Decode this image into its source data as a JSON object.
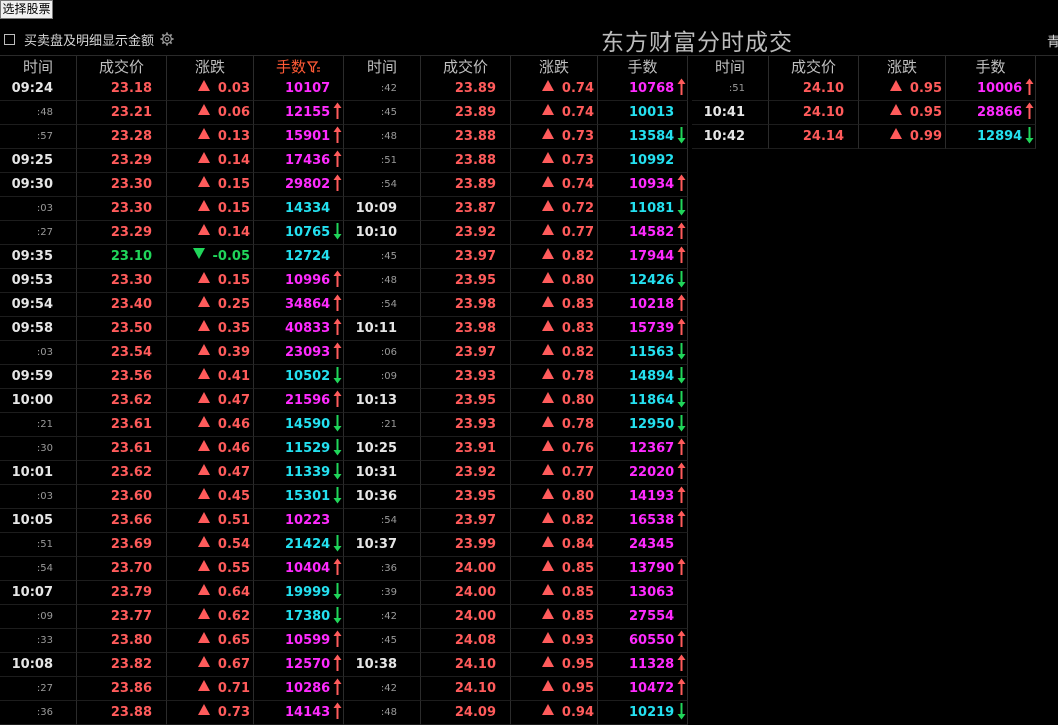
{
  "toolbar": {
    "select_stock_label": "选择股票",
    "show_amount_label": "买卖盘及明细显示金额",
    "show_amount_checked": false
  },
  "title": "东方财富分时成交",
  "corner_text": "青",
  "headers": [
    "时间",
    "成交价",
    "涨跌",
    "手数",
    "时间",
    "成交价",
    "涨跌",
    "手数",
    "时间",
    "成交价",
    "涨跌",
    "手数"
  ],
  "active_header_index": 3,
  "colors": {
    "up": "#ff5b5b",
    "down": "#20d65a",
    "buy_volume": "#ff2bff",
    "sell_volume": "#24e0f0",
    "active_header": "#ff5a36"
  },
  "columns": [
    [
      {
        "time": "09:24",
        "price": "23.18",
        "change": "0.03",
        "dir": "up",
        "vol": "10107",
        "side": "buy",
        "arrow": "none"
      },
      {
        "time": ":48",
        "price": "23.21",
        "change": "0.06",
        "dir": "up",
        "vol": "12155",
        "side": "buy",
        "arrow": "up"
      },
      {
        "time": ":57",
        "price": "23.28",
        "change": "0.13",
        "dir": "up",
        "vol": "15901",
        "side": "buy",
        "arrow": "up"
      },
      {
        "time": "09:25",
        "price": "23.29",
        "change": "0.14",
        "dir": "up",
        "vol": "17436",
        "side": "buy",
        "arrow": "up"
      },
      {
        "time": "09:30",
        "price": "23.30",
        "change": "0.15",
        "dir": "up",
        "vol": "29802",
        "side": "buy",
        "arrow": "up"
      },
      {
        "time": ":03",
        "price": "23.30",
        "change": "0.15",
        "dir": "up",
        "vol": "14334",
        "side": "sell",
        "arrow": "none"
      },
      {
        "time": ":27",
        "price": "23.29",
        "change": "0.14",
        "dir": "up",
        "vol": "10765",
        "side": "sell",
        "arrow": "down"
      },
      {
        "time": "09:35",
        "price": "23.10",
        "change": "-0.05",
        "dir": "down",
        "vol": "12724",
        "side": "sell",
        "arrow": "none"
      },
      {
        "time": "09:53",
        "price": "23.30",
        "change": "0.15",
        "dir": "up",
        "vol": "10996",
        "side": "buy",
        "arrow": "up"
      },
      {
        "time": "09:54",
        "price": "23.40",
        "change": "0.25",
        "dir": "up",
        "vol": "34864",
        "side": "buy",
        "arrow": "up"
      },
      {
        "time": "09:58",
        "price": "23.50",
        "change": "0.35",
        "dir": "up",
        "vol": "40833",
        "side": "buy",
        "arrow": "up"
      },
      {
        "time": ":03",
        "price": "23.54",
        "change": "0.39",
        "dir": "up",
        "vol": "23093",
        "side": "buy",
        "arrow": "up"
      },
      {
        "time": "09:59",
        "price": "23.56",
        "change": "0.41",
        "dir": "up",
        "vol": "10502",
        "side": "sell",
        "arrow": "down"
      },
      {
        "time": "10:00",
        "price": "23.62",
        "change": "0.47",
        "dir": "up",
        "vol": "21596",
        "side": "buy",
        "arrow": "up"
      },
      {
        "time": ":21",
        "price": "23.61",
        "change": "0.46",
        "dir": "up",
        "vol": "14590",
        "side": "sell",
        "arrow": "down"
      },
      {
        "time": ":30",
        "price": "23.61",
        "change": "0.46",
        "dir": "up",
        "vol": "11529",
        "side": "sell",
        "arrow": "down"
      },
      {
        "time": "10:01",
        "price": "23.62",
        "change": "0.47",
        "dir": "up",
        "vol": "11339",
        "side": "sell",
        "arrow": "down"
      },
      {
        "time": ":03",
        "price": "23.60",
        "change": "0.45",
        "dir": "up",
        "vol": "15301",
        "side": "sell",
        "arrow": "down"
      },
      {
        "time": "10:05",
        "price": "23.66",
        "change": "0.51",
        "dir": "up",
        "vol": "10223",
        "side": "buy",
        "arrow": "none"
      },
      {
        "time": ":51",
        "price": "23.69",
        "change": "0.54",
        "dir": "up",
        "vol": "21424",
        "side": "sell",
        "arrow": "down"
      },
      {
        "time": ":54",
        "price": "23.70",
        "change": "0.55",
        "dir": "up",
        "vol": "10404",
        "side": "buy",
        "arrow": "up"
      },
      {
        "time": "10:07",
        "price": "23.79",
        "change": "0.64",
        "dir": "up",
        "vol": "19999",
        "side": "sell",
        "arrow": "down"
      },
      {
        "time": ":09",
        "price": "23.77",
        "change": "0.62",
        "dir": "up",
        "vol": "17380",
        "side": "sell",
        "arrow": "down"
      },
      {
        "time": ":33",
        "price": "23.80",
        "change": "0.65",
        "dir": "up",
        "vol": "10599",
        "side": "buy",
        "arrow": "up"
      },
      {
        "time": "10:08",
        "price": "23.82",
        "change": "0.67",
        "dir": "up",
        "vol": "12570",
        "side": "buy",
        "arrow": "up"
      },
      {
        "time": ":27",
        "price": "23.86",
        "change": "0.71",
        "dir": "up",
        "vol": "10286",
        "side": "buy",
        "arrow": "up"
      },
      {
        "time": ":36",
        "price": "23.88",
        "change": "0.73",
        "dir": "up",
        "vol": "14143",
        "side": "buy",
        "arrow": "up"
      }
    ],
    [
      {
        "time": ":42",
        "price": "23.89",
        "change": "0.74",
        "dir": "up",
        "vol": "10768",
        "side": "buy",
        "arrow": "up"
      },
      {
        "time": ":45",
        "price": "23.89",
        "change": "0.74",
        "dir": "up",
        "vol": "10013",
        "side": "sell",
        "arrow": "none"
      },
      {
        "time": ":48",
        "price": "23.88",
        "change": "0.73",
        "dir": "up",
        "vol": "13584",
        "side": "sell",
        "arrow": "down"
      },
      {
        "time": ":51",
        "price": "23.88",
        "change": "0.73",
        "dir": "up",
        "vol": "10992",
        "side": "sell",
        "arrow": "none"
      },
      {
        "time": ":54",
        "price": "23.89",
        "change": "0.74",
        "dir": "up",
        "vol": "10934",
        "side": "buy",
        "arrow": "up"
      },
      {
        "time": "10:09",
        "price": "23.87",
        "change": "0.72",
        "dir": "up",
        "vol": "11081",
        "side": "sell",
        "arrow": "down"
      },
      {
        "time": "10:10",
        "price": "23.92",
        "change": "0.77",
        "dir": "up",
        "vol": "14582",
        "side": "buy",
        "arrow": "up"
      },
      {
        "time": ":45",
        "price": "23.97",
        "change": "0.82",
        "dir": "up",
        "vol": "17944",
        "side": "buy",
        "arrow": "up"
      },
      {
        "time": ":48",
        "price": "23.95",
        "change": "0.80",
        "dir": "up",
        "vol": "12426",
        "side": "sell",
        "arrow": "down"
      },
      {
        "time": ":54",
        "price": "23.98",
        "change": "0.83",
        "dir": "up",
        "vol": "10218",
        "side": "buy",
        "arrow": "up"
      },
      {
        "time": "10:11",
        "price": "23.98",
        "change": "0.83",
        "dir": "up",
        "vol": "15739",
        "side": "buy",
        "arrow": "up"
      },
      {
        "time": ":06",
        "price": "23.97",
        "change": "0.82",
        "dir": "up",
        "vol": "11563",
        "side": "sell",
        "arrow": "down"
      },
      {
        "time": ":09",
        "price": "23.93",
        "change": "0.78",
        "dir": "up",
        "vol": "14894",
        "side": "sell",
        "arrow": "down"
      },
      {
        "time": "10:13",
        "price": "23.95",
        "change": "0.80",
        "dir": "up",
        "vol": "11864",
        "side": "sell",
        "arrow": "down"
      },
      {
        "time": ":21",
        "price": "23.93",
        "change": "0.78",
        "dir": "up",
        "vol": "12950",
        "side": "sell",
        "arrow": "down"
      },
      {
        "time": "10:25",
        "price": "23.91",
        "change": "0.76",
        "dir": "up",
        "vol": "12367",
        "side": "buy",
        "arrow": "up"
      },
      {
        "time": "10:31",
        "price": "23.92",
        "change": "0.77",
        "dir": "up",
        "vol": "22020",
        "side": "buy",
        "arrow": "up"
      },
      {
        "time": "10:36",
        "price": "23.95",
        "change": "0.80",
        "dir": "up",
        "vol": "14193",
        "side": "buy",
        "arrow": "up"
      },
      {
        "time": ":54",
        "price": "23.97",
        "change": "0.82",
        "dir": "up",
        "vol": "16538",
        "side": "buy",
        "arrow": "up"
      },
      {
        "time": "10:37",
        "price": "23.99",
        "change": "0.84",
        "dir": "up",
        "vol": "24345",
        "side": "buy",
        "arrow": "none"
      },
      {
        "time": ":36",
        "price": "24.00",
        "change": "0.85",
        "dir": "up",
        "vol": "13790",
        "side": "buy",
        "arrow": "up"
      },
      {
        "time": ":39",
        "price": "24.00",
        "change": "0.85",
        "dir": "up",
        "vol": "13063",
        "side": "buy",
        "arrow": "none"
      },
      {
        "time": ":42",
        "price": "24.00",
        "change": "0.85",
        "dir": "up",
        "vol": "27554",
        "side": "buy",
        "arrow": "none"
      },
      {
        "time": ":45",
        "price": "24.08",
        "change": "0.93",
        "dir": "up",
        "vol": "60550",
        "side": "buy",
        "arrow": "up"
      },
      {
        "time": "10:38",
        "price": "24.10",
        "change": "0.95",
        "dir": "up",
        "vol": "11328",
        "side": "buy",
        "arrow": "up"
      },
      {
        "time": ":42",
        "price": "24.10",
        "change": "0.95",
        "dir": "up",
        "vol": "10472",
        "side": "buy",
        "arrow": "up"
      },
      {
        "time": ":48",
        "price": "24.09",
        "change": "0.94",
        "dir": "up",
        "vol": "10219",
        "side": "sell",
        "arrow": "down"
      }
    ],
    [
      {
        "time": ":51",
        "price": "24.10",
        "change": "0.95",
        "dir": "up",
        "vol": "10006",
        "side": "buy",
        "arrow": "up"
      },
      {
        "time": "10:41",
        "price": "24.10",
        "change": "0.95",
        "dir": "up",
        "vol": "28866",
        "side": "buy",
        "arrow": "up"
      },
      {
        "time": "10:42",
        "price": "24.14",
        "change": "0.99",
        "dir": "up",
        "vol": "12894",
        "side": "sell",
        "arrow": "down"
      }
    ]
  ]
}
